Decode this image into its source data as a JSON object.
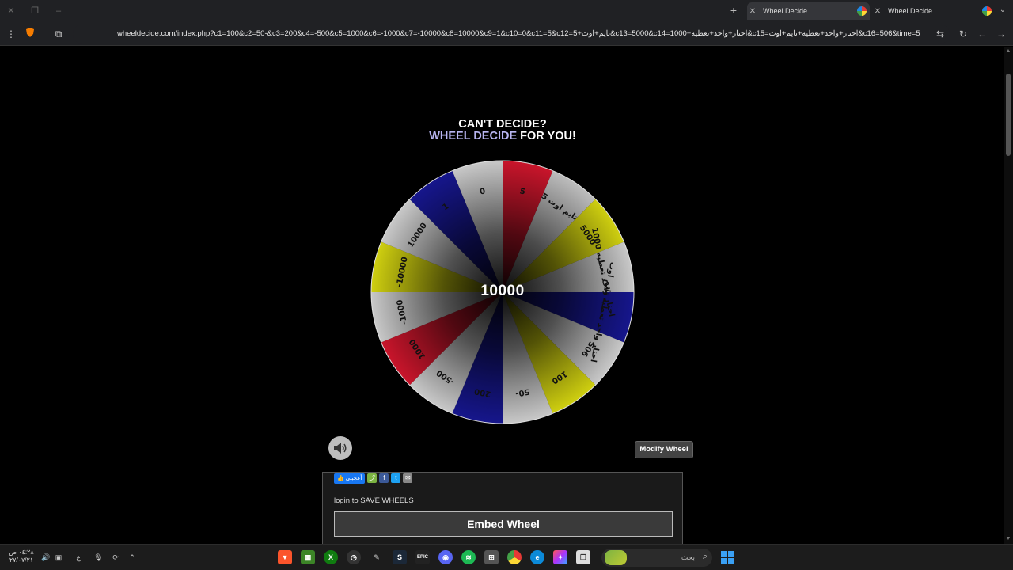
{
  "browser": {
    "tabs": [
      {
        "title": "Wheel Decide"
      },
      {
        "title": "Wheel Decide"
      }
    ],
    "url": "wheeldecide.com/index.php?c1=100&c2=50-&c3=200&c4=-500&c5=1000&c6=-1000&c7=-10000&c8=10000&c9=1&c10=0&c11=5&c12=5+تايم+اوت&c13=5000&c14=1000+احتار+واحد+تعطيه&c15=احتار+واحد+تعطيه+تايم+اوت&c16=506&time=5"
  },
  "headline": {
    "line1": "CAN'T DECIDE?",
    "accent": "WHEEL DECIDE",
    "rest": " FOR YOU!"
  },
  "wheel": {
    "result": "10000",
    "segments": [
      {
        "label": "5",
        "color": "#c9152b"
      },
      {
        "label": "5 تايم اوت",
        "color": "#bdbdbd"
      },
      {
        "label": "5000",
        "color": "#cfcf10"
      },
      {
        "label": "1000 احتار واحد تعطيه",
        "color": "#c8c8c8"
      },
      {
        "label": "احتار واحد تعطيه تايم اوت",
        "color": "#16168c"
      },
      {
        "label": "506",
        "color": "#c8c8c8"
      },
      {
        "label": "100",
        "color": "#cfcf10"
      },
      {
        "label": "50-",
        "color": "#c8c8c8"
      },
      {
        "label": "200",
        "color": "#16168c"
      },
      {
        "label": "-500",
        "color": "#c8c8c8"
      },
      {
        "label": "1000",
        "color": "#c9152b"
      },
      {
        "label": "-1000",
        "color": "#c8c8c8"
      },
      {
        "label": "-10000",
        "color": "#cfcf10"
      },
      {
        "label": "10000",
        "color": "#c8c8c8"
      },
      {
        "label": "1",
        "color": "#16168c"
      },
      {
        "label": "0",
        "color": "#c8c8c8"
      }
    ]
  },
  "controls": {
    "modify_label": "Modify Wheel"
  },
  "panel": {
    "like_label": "أعجبني",
    "login_text": "login to SAVE WHEELS",
    "embed_label": "Embed Wheel"
  },
  "taskbar": {
    "time": "٠٤:٢٨ ص",
    "date": "٢٧/٠٧/٢١",
    "lang": "ع",
    "search_label": "بحث"
  }
}
